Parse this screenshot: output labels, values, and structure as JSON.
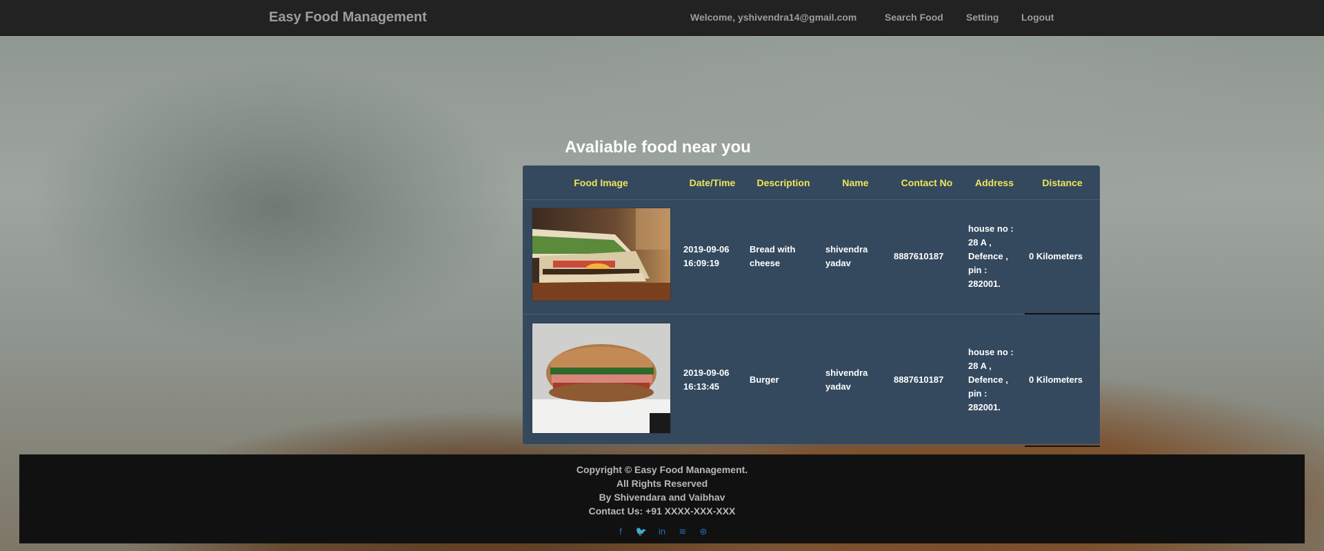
{
  "navbar": {
    "brand": "Easy Food Management",
    "welcome": "Welcome, yshivendra14@gmail.com",
    "search_food": "Search Food",
    "setting": "Setting",
    "logout": "Logout"
  },
  "main": {
    "heading": "Avaliable food near you",
    "columns": [
      "Food Image",
      "Date/Time",
      "Description",
      "Name",
      "Contact No",
      "Address",
      "Distance"
    ],
    "rows": [
      {
        "image": "sandwich-photo",
        "date": "2019-09-06",
        "time": "16:09:19",
        "description": "Bread with cheese",
        "name": "shivendra yadav",
        "contact": "8887610187",
        "address": "house no : 28 A , Defence , pin : 282001.",
        "distance": "0 Kilometers"
      },
      {
        "image": "burger-photo",
        "date": "2019-09-06",
        "time": "16:13:45",
        "description": "Burger",
        "name": "shivendra yadav",
        "contact": "8887610187",
        "address": "house no : 28 A , Defence , pin : 282001.",
        "distance": "0 Kilometers"
      }
    ]
  },
  "footer": {
    "copyright": "Copyright © Easy Food Management.",
    "rights": "All Rights Reserved",
    "authors": "By Shivendara and Vaibhav",
    "contact": "Contact Us: +91 XXXX-XXX-XXX",
    "social_icons": [
      "facebook-icon",
      "twitter-icon",
      "linkedin-icon",
      "rss-icon",
      "dribbble-icon"
    ],
    "social_glyphs": [
      "f",
      "🐦",
      "in",
      "≋",
      "⊛"
    ]
  },
  "colors": {
    "navbar_bg": "#222222",
    "panel_bg": "#34495e",
    "header_text": "#f0e65a",
    "footer_bg": "#111111",
    "social_icon": "#2a6fb8"
  }
}
